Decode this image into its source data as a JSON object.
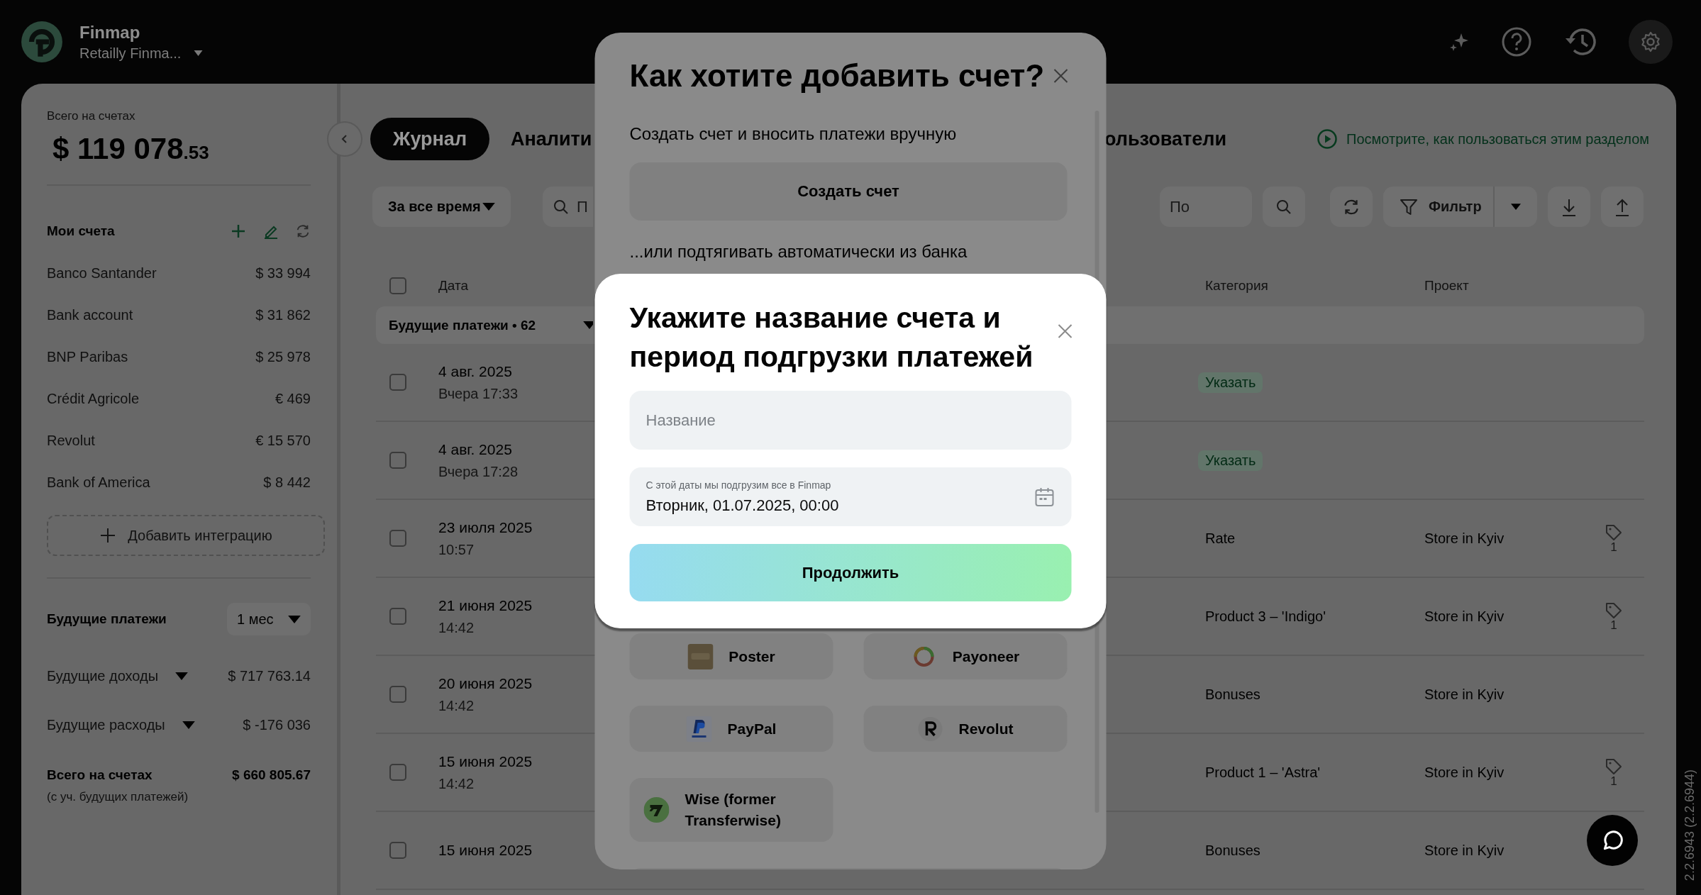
{
  "app": {
    "name": "Finmap",
    "workspace": "Retailly Finma..."
  },
  "sidebar": {
    "total_label": "Всего на счетах",
    "total_whole": "$ 119 078",
    "total_fraction": ".53",
    "accounts_title": "Мои счета",
    "accounts": [
      {
        "name": "Banco Santander",
        "amount": "$  33 994"
      },
      {
        "name": "Bank account",
        "amount": "$  31 862"
      },
      {
        "name": "BNP Paribas",
        "amount": "$  25 978"
      },
      {
        "name": "Crédit Agricole",
        "amount": "€ 469"
      },
      {
        "name": "Revolut",
        "amount": "€ 15 570"
      },
      {
        "name": "Bank of America",
        "amount": "$  8 442"
      }
    ],
    "add_integration": "Добавить интеграцию",
    "future_title": "Будущие платежи",
    "period": "1 мес",
    "future_rows": [
      {
        "label": "Будущие доходы",
        "amount": "$  717 763.14"
      },
      {
        "label": "Будущие расходы",
        "amount": "$  -176 036"
      }
    ],
    "grand_total_label": "Всего на счетах",
    "grand_total": "$  660 805.67",
    "grand_total_note": "(с уч. будущих платежей)"
  },
  "tabs": [
    {
      "label": "Журнал",
      "selected": true
    },
    {
      "label": "Аналити",
      "selected": false
    },
    {
      "label": "ользователи",
      "selected": false
    }
  ],
  "help_link": "Посмотрите, как пользоваться этим разделом",
  "toolbar": {
    "period": "За все время",
    "search_placeholder": "П",
    "second_search_placeholder": "По",
    "filter": "Фильтр"
  },
  "table": {
    "columns": [
      "Дата",
      "Категория",
      "Проект"
    ],
    "all_checked": false,
    "group": "Будущие платежи • 62",
    "rows": [
      {
        "checked": false,
        "date": "4 авг. 2025",
        "time": "Вчера 17:33",
        "category": "Указать",
        "kind": "chip"
      },
      {
        "checked": false,
        "date": "4 авг. 2025",
        "time": "Вчера 17:28",
        "category": "Указать",
        "kind": "chip"
      },
      {
        "checked": false,
        "date": "23 июля 2025",
        "time": "10:57",
        "category": "Rate",
        "kind": "text",
        "project": "Store in Kyiv",
        "tag_count": "1"
      },
      {
        "checked": false,
        "date": "21 июня 2025",
        "time": "14:42",
        "category": "Product 3 – 'Indigo'",
        "kind": "text",
        "project": "Store in Kyiv",
        "tag_count": "1"
      },
      {
        "checked": false,
        "date": "20 июня 2025",
        "time": "14:42",
        "category": "Bonuses",
        "kind": "text",
        "project": "Store in Kyiv"
      },
      {
        "checked": false,
        "date": "15 июня 2025",
        "time": "14:42",
        "category": "Product 1 – 'Astra'",
        "kind": "text",
        "project": "Store in Kyiv",
        "tag_count": "1"
      },
      {
        "checked": false,
        "date": "15 июня 2025",
        "category": "Bonuses",
        "kind": "text",
        "project": "Store in Kyiv"
      }
    ]
  },
  "dialog_add": {
    "title": "Как хотите добавить счет?",
    "manual_text": "Создать счет и вносить платежи вручную",
    "create_button": "Создать счет",
    "auto_text": "...или подтягивать автоматически из банка",
    "integrations": [
      {
        "name": "Poster",
        "kind": "poster"
      },
      {
        "name": "Payoneer",
        "kind": "payoneer"
      },
      {
        "name": "PayPal",
        "kind": "paypal"
      },
      {
        "name": "Revolut",
        "kind": "revolut"
      },
      {
        "name": "Wise (former Transferwise)",
        "kind": "wise"
      }
    ]
  },
  "dialog_name": {
    "title": "Укажите название счета и период подгрузки платежей",
    "name_placeholder": "Название",
    "date_label": "С этой даты мы подгрузим все в Finmap",
    "date_value": "Вторник, 01.07.2025, 00:00",
    "continue_button": "Продолжить"
  },
  "version": "2.2.6943 (2.2.6944)"
}
